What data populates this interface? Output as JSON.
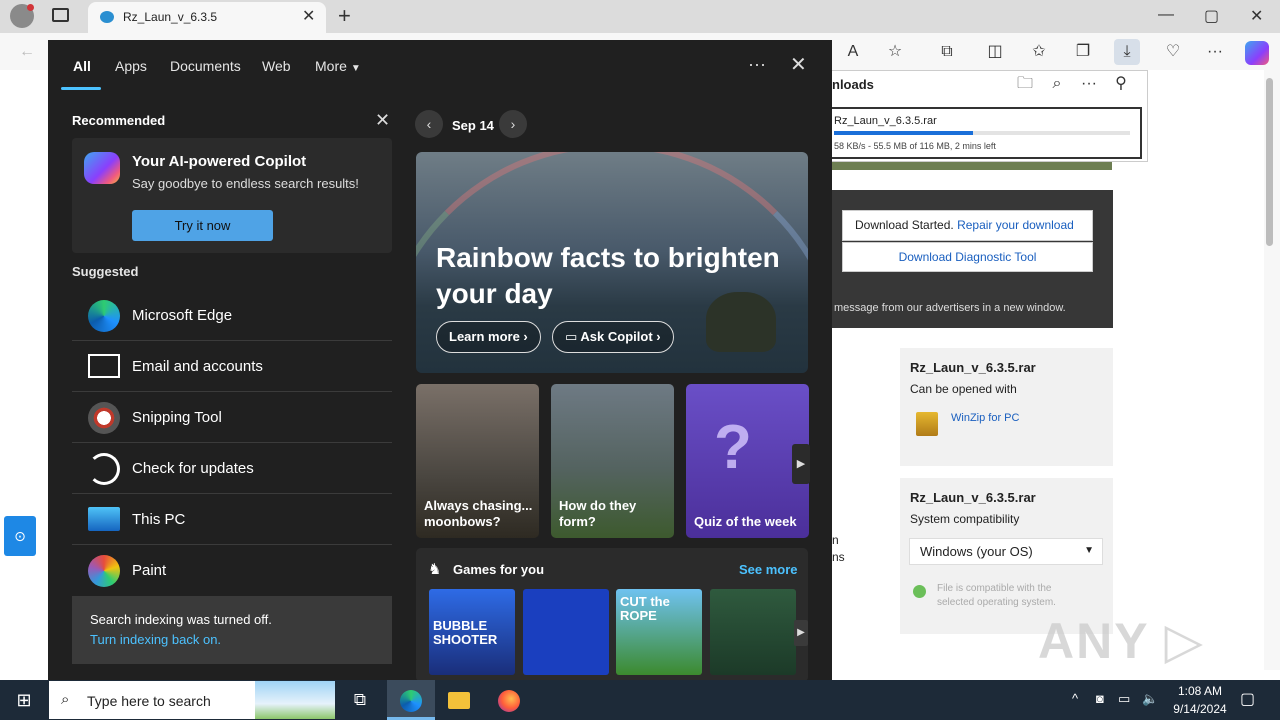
{
  "browser": {
    "tab_title": "Rz_Laun_v_6.3.5",
    "tab_close": "✕",
    "new_tab": "+",
    "window_controls": {
      "minimize": "—",
      "maximize": "▢",
      "close": "✕"
    },
    "toolbar_icons": [
      "read-aloud-icon",
      "favorite-star-icon",
      "extensions-icon",
      "split-screen-icon",
      "favorites-icon",
      "collections-icon",
      "downloads-icon",
      "browser-essentials-icon",
      "more-icon",
      "copilot-icon"
    ]
  },
  "downloads": {
    "title": "nloads",
    "file": "Rz_Laun_v_6.3.5.rar",
    "progress": 0.47,
    "status": "58 KB/s - 55.5 MB of 116 MB, 2 mins left"
  },
  "webpage": {
    "started": "Download Started.",
    "repair": "Repair your download",
    "diagnostic": "Download Diagnostic Tool",
    "advertisers": "message from our advertisers in a new window.",
    "card1": {
      "title": "Rz_Laun_v_6.3.5.rar",
      "sub": "Can be opened with",
      "app": "WinZip for PC"
    },
    "card2": {
      "title": "Rz_Laun_v_6.3.5.rar",
      "sub": "System compatibility",
      "os": "Windows (your OS)",
      "compat": "File is compatible with the selected operating system."
    },
    "frag1": "n\nns",
    "watermark": "ANY ▷ RUN"
  },
  "search_panel": {
    "tabs": [
      "All",
      "Apps",
      "Documents",
      "Web",
      "More"
    ],
    "dots": "···",
    "close": "✕",
    "recommended": "Recommended",
    "copilot": {
      "title": "Your AI-powered Copilot",
      "sub": "Say goodbye to endless search results!",
      "button": "Try it now"
    },
    "suggested": "Suggested",
    "apps": [
      "Microsoft Edge",
      "Email and accounts",
      "Snipping Tool",
      "Check for updates",
      "This PC",
      "Paint"
    ],
    "indexing": {
      "text": "Search indexing was turned off.",
      "link": "Turn indexing back on."
    },
    "date": "Sep 14",
    "hero": {
      "title": "Rainbow facts to brighten your day",
      "learn": "Learn more",
      "ask": "Ask Copilot"
    },
    "tiles": [
      "Always chasing... moonbows?",
      "How do they form?",
      "Quiz of the week"
    ],
    "games": {
      "title": "Games for you",
      "see_more": "See more",
      "items": [
        "BUBBLE SHOOTER",
        "",
        "CUT the ROPE",
        ""
      ]
    }
  },
  "taskbar": {
    "search_placeholder": "Type here to search",
    "time": "1:08 AM",
    "date": "9/14/2024"
  }
}
